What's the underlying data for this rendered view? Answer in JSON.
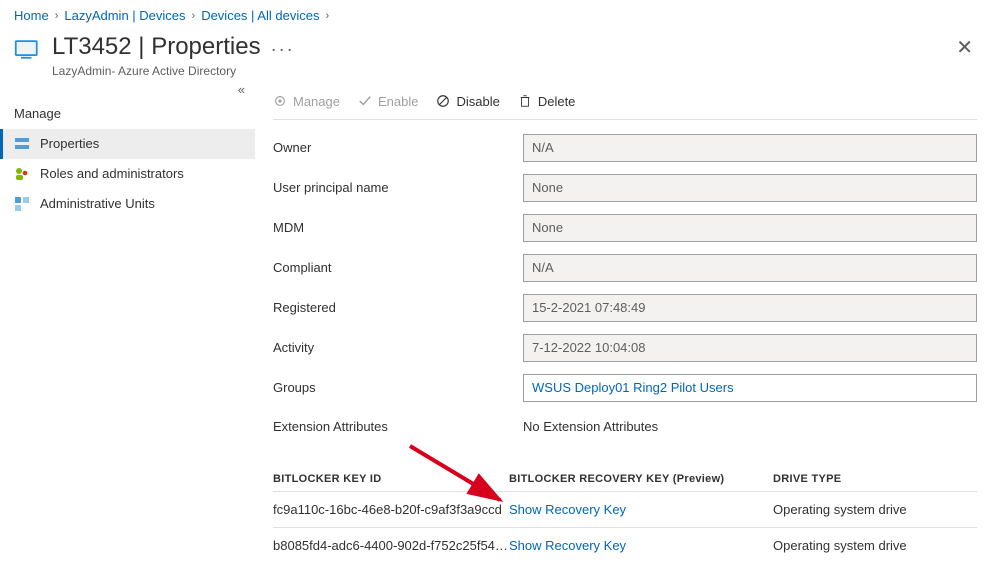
{
  "breadcrumb": [
    {
      "label": "Home"
    },
    {
      "label": "LazyAdmin | Devices"
    },
    {
      "label": "Devices | All devices"
    }
  ],
  "header": {
    "title": "LT3452 | Properties",
    "subtitle": "LazyAdmin- Azure Active Directory"
  },
  "sidebar": {
    "section": "Manage",
    "items": [
      {
        "label": "Properties",
        "active": true
      },
      {
        "label": "Roles and administrators",
        "active": false
      },
      {
        "label": "Administrative Units",
        "active": false
      }
    ]
  },
  "toolbar": {
    "manage": "Manage",
    "enable": "Enable",
    "disable": "Disable",
    "delete": "Delete"
  },
  "props": {
    "owner_label": "Owner",
    "owner_value": "N/A",
    "upn_label": "User principal name",
    "upn_value": "None",
    "mdm_label": "MDM",
    "mdm_value": "None",
    "compliant_label": "Compliant",
    "compliant_value": "N/A",
    "registered_label": "Registered",
    "registered_value": "15-2-2021 07:48:49",
    "activity_label": "Activity",
    "activity_value": "7-12-2022 10:04:08",
    "groups_label": "Groups",
    "groups_value": "WSUS Deploy01 Ring2 Pilot Users",
    "ext_label": "Extension Attributes",
    "ext_value": "No Extension Attributes"
  },
  "bitlocker": {
    "col1": "BITLOCKER KEY ID",
    "col2": "BITLOCKER RECOVERY KEY (Preview)",
    "col3": "DRIVE TYPE",
    "rows": [
      {
        "id": "fc9a110c-16bc-46e8-b20f-c9af3f3a9ccd",
        "link": "Show Recovery Key",
        "drive": "Operating system drive"
      },
      {
        "id": "b8085fd4-adc6-4400-902d-f752c25f54…",
        "link": "Show Recovery Key",
        "drive": "Operating system drive"
      }
    ]
  }
}
